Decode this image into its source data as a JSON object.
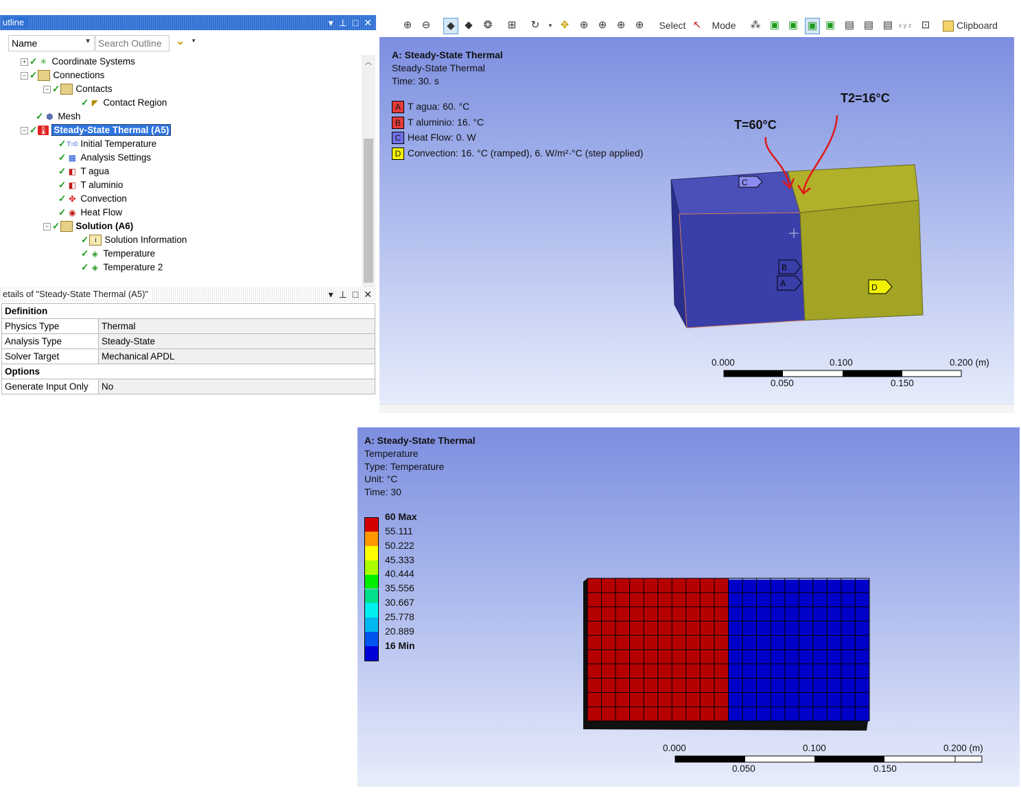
{
  "outline": {
    "title": "utline",
    "name_combo": "Name",
    "search_placeholder": "Search Outline",
    "tree": [
      {
        "label": "Coordinate Systems",
        "icon": "coordinate-systems-icon"
      },
      {
        "label": "Connections",
        "icon": "folder-icon"
      },
      {
        "label": "Contacts",
        "icon": "contacts-icon"
      },
      {
        "label": "Contact Region",
        "icon": "contact-region-icon"
      },
      {
        "label": "Mesh",
        "icon": "mesh-icon"
      },
      {
        "label": "Steady-State Thermal (A5)",
        "icon": "thermal-analysis-icon"
      },
      {
        "label": "Initial Temperature",
        "icon": "initial-temperature-icon",
        "glyph": "T=0"
      },
      {
        "label": "Analysis Settings",
        "icon": "analysis-settings-icon"
      },
      {
        "label": "T agua",
        "icon": "temperature-bc-icon"
      },
      {
        "label": "T aluminio",
        "icon": "temperature-bc-icon"
      },
      {
        "label": "Convection",
        "icon": "convection-icon"
      },
      {
        "label": "Heat Flow",
        "icon": "heat-flow-icon"
      },
      {
        "label": "Solution (A6)",
        "icon": "solution-icon"
      },
      {
        "label": "Solution Information",
        "icon": "solution-information-icon"
      },
      {
        "label": "Temperature",
        "icon": "temperature-result-icon"
      },
      {
        "label": "Temperature 2",
        "icon": "temperature-result-icon"
      }
    ]
  },
  "details": {
    "title": "etails of \"Steady-State Thermal (A5)\"",
    "groups": [
      {
        "name": "Definition",
        "rows": [
          {
            "key": "Physics Type",
            "value": "Thermal"
          },
          {
            "key": "Analysis Type",
            "value": "Steady-State"
          },
          {
            "key": "Solver Target",
            "value": "Mechanical APDL"
          }
        ]
      },
      {
        "name": "Options",
        "rows": [
          {
            "key": "Generate Input Only",
            "value": "No"
          }
        ]
      }
    ]
  },
  "toolbar": {
    "select_label": "Select",
    "mode_label": "Mode",
    "clipboard_label": "Clipboard",
    "xyz_label": "x y z"
  },
  "view1": {
    "title": "A: Steady-State Thermal",
    "subtitle": "Steady-State Thermal",
    "time": "Time: 30. s",
    "legend": [
      {
        "tag": "A",
        "text": "T agua: 60. °C",
        "color": "#e53b3b"
      },
      {
        "tag": "B",
        "text": "T aluminio: 16. °C",
        "color": "#e53b3b"
      },
      {
        "tag": "C",
        "text": "Heat Flow: 0. W",
        "color": "#7070e8"
      },
      {
        "tag": "D",
        "text": "Convection: 16. °C  (ramped), 6. W/m²·°C  (step applied)",
        "color": "#f2f200"
      }
    ],
    "annot_t1": "T=60°C",
    "annot_t2": "T2=16°C",
    "scale_top": [
      "0.000",
      "0.100",
      "0.200 (m)"
    ],
    "scale_bottom": [
      "0.050",
      "0.150"
    ]
  },
  "view2": {
    "title": "A: Steady-State Thermal",
    "line1": "Temperature",
    "line2": "Type: Temperature",
    "line3": "Unit: °C",
    "line4": "Time: 30",
    "colorbar": {
      "labels": [
        "60 Max",
        "55.111",
        "50.222",
        "45.333",
        "40.444",
        "35.556",
        "30.667",
        "25.778",
        "20.889",
        "16 Min"
      ],
      "colors": [
        "#d40000",
        "#ff9900",
        "#ffff00",
        "#aaff00",
        "#00ee00",
        "#00e08a",
        "#00f0f0",
        "#00b8f0",
        "#0055f0",
        "#0000d8"
      ]
    },
    "scale_top": [
      "0.000",
      "0.100",
      "0.200 (m)"
    ],
    "scale_bottom": [
      "0.050",
      "0.150"
    ]
  }
}
